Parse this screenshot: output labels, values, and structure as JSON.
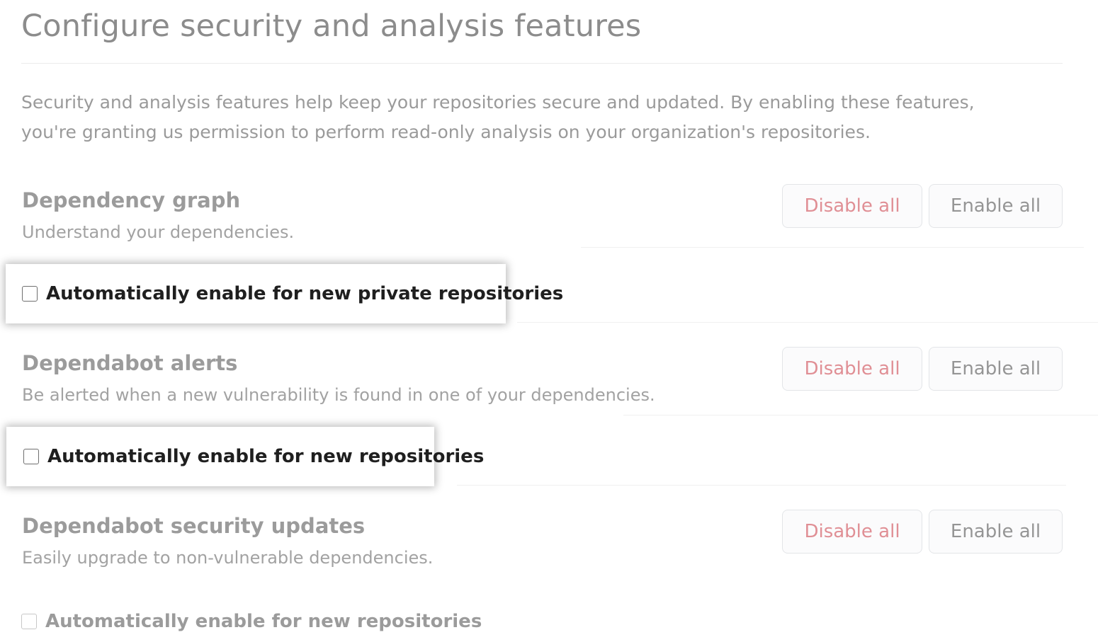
{
  "page_title": "Configure security and analysis features",
  "intro": "Security and analysis features help keep your repositories secure and updated. By enabling these features, you're granting us permission to perform read-only analysis on your organization's repositories.",
  "sections": [
    {
      "title": "Dependency graph",
      "description": "Understand your dependencies.",
      "disable_label": "Disable all",
      "enable_label": "Enable all",
      "checkbox_label": "Automatically enable for new private repositories",
      "checked": false
    },
    {
      "title": "Dependabot alerts",
      "description": "Be alerted when a new vulnerability is found in one of your dependencies.",
      "disable_label": "Disable all",
      "enable_label": "Enable all",
      "checkbox_label": "Automatically enable for new repositories",
      "checked": false
    },
    {
      "title": "Dependabot security updates",
      "description": "Easily upgrade to non-vulnerable dependencies.",
      "disable_label": "Disable all",
      "enable_label": "Enable all",
      "checkbox_label": "Automatically enable for new repositories",
      "checked": false
    }
  ],
  "colors": {
    "danger_text": "#e08f95",
    "muted_text": "#9b9b9b",
    "highlight_text": "#1f1f1f"
  }
}
